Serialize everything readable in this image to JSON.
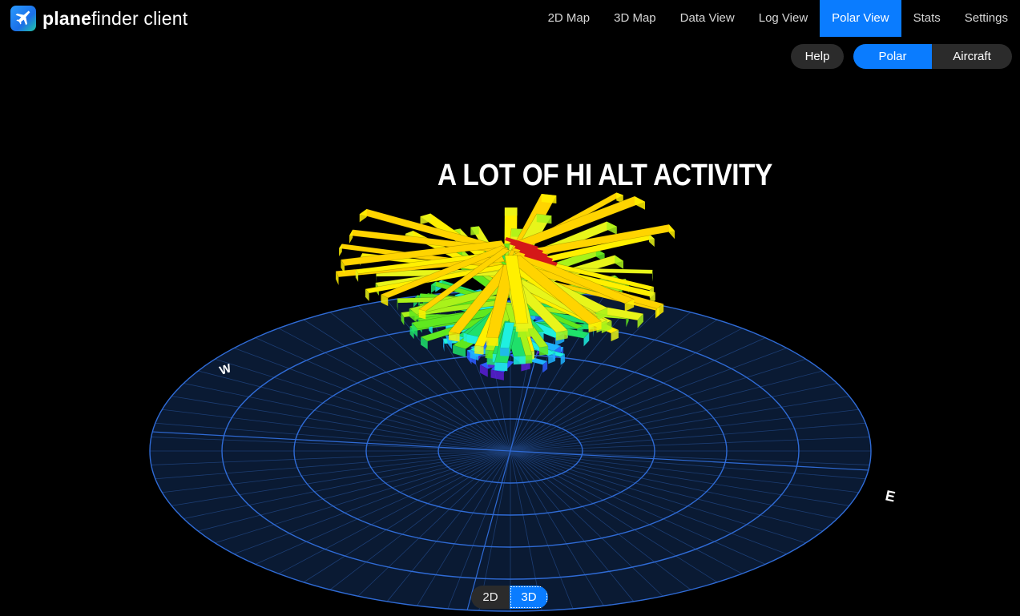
{
  "app": {
    "brand_bold": "plane",
    "brand_rest": "finder client"
  },
  "nav": [
    {
      "label": "2D Map",
      "active": false
    },
    {
      "label": "3D Map",
      "active": false
    },
    {
      "label": "Data View",
      "active": false
    },
    {
      "label": "Log View",
      "active": false
    },
    {
      "label": "Polar View",
      "active": true
    },
    {
      "label": "Stats",
      "active": false
    },
    {
      "label": "Settings",
      "active": false
    }
  ],
  "subnav": {
    "help": "Help",
    "polar": "Polar",
    "aircraft": "Aircraft"
  },
  "annotation": "A LOT OF HI ALT ACTIVITY",
  "compass": {
    "west": "W",
    "east": "E"
  },
  "view_toggle": {
    "two_d": "2D",
    "three_d": "3D",
    "selected": "3D"
  },
  "colors": {
    "accent": "#0a7cff",
    "grid": "#2f6bd6",
    "background": "#000000"
  }
}
